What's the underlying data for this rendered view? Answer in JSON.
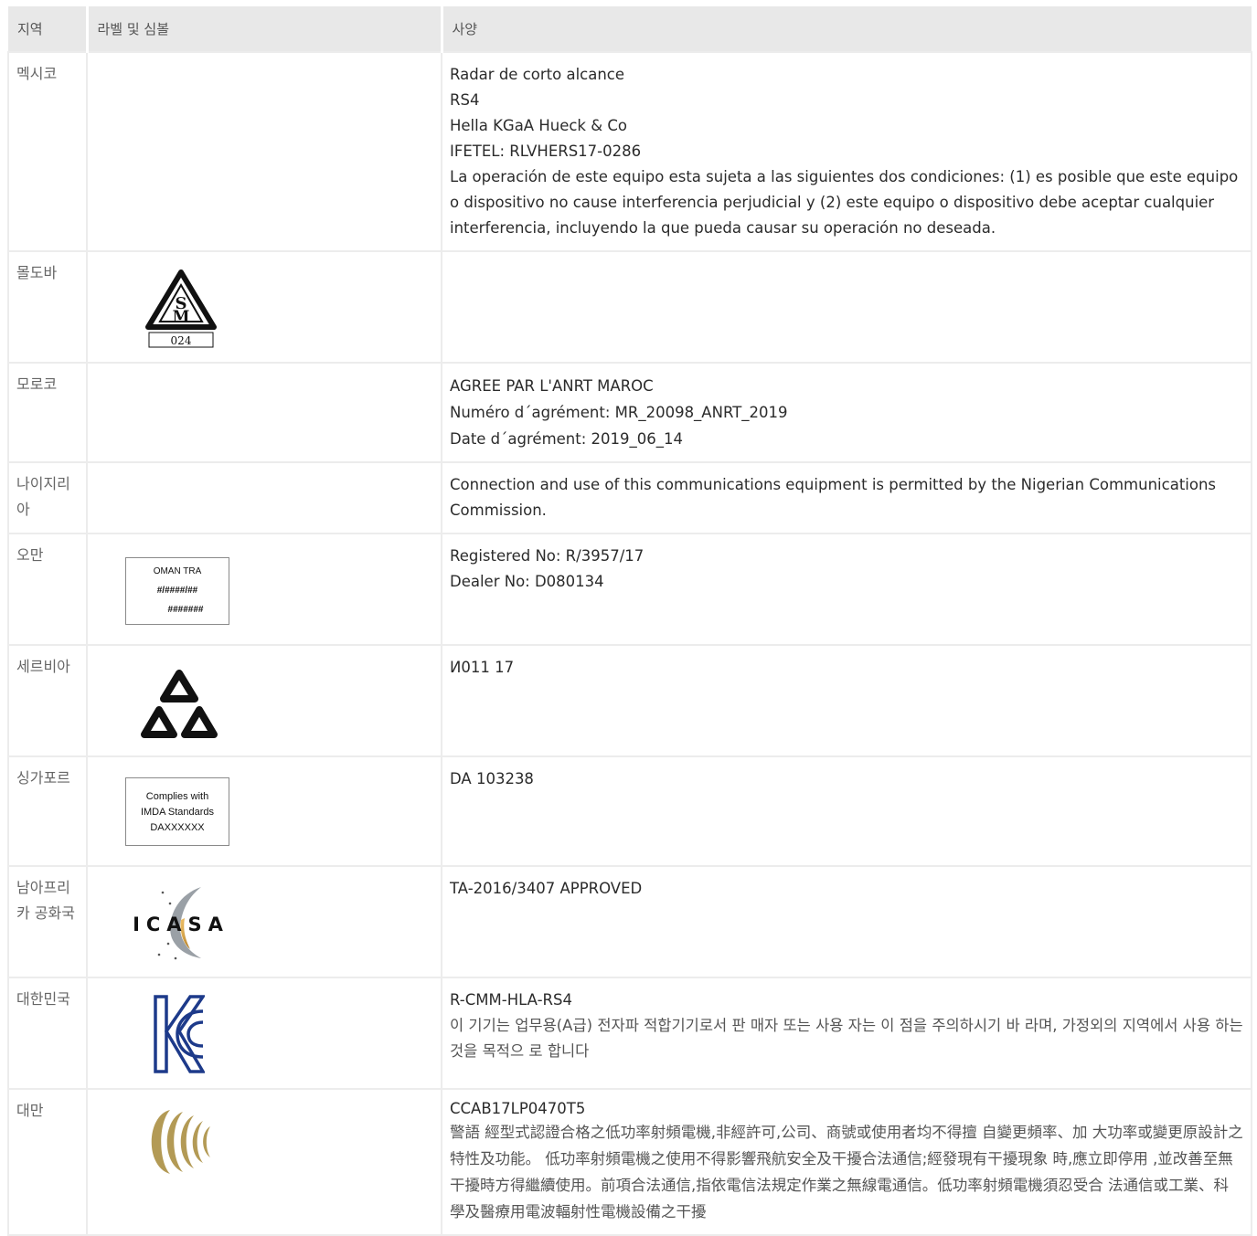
{
  "header": {
    "region": "지역",
    "label": "라벨 및 심볼",
    "spec": "사양"
  },
  "rows": [
    {
      "region": "멕시코",
      "spec": [
        "Radar de corto alcance",
        "RS4",
        "Hella KGaA Hueck & Co",
        "IFETEL: RLVHERS17-0286",
        "La operación de este equipo esta sujeta a las siguientes dos condiciones: (1) es posible que este equipo o dispositivo no cause interferencia perjudicial y (2) este equipo o dispositivo debe aceptar cualquier interferencia, incluyendo la que pueda causar su operación no deseada."
      ]
    },
    {
      "region": "몰도바",
      "label_logo": "moldova-sm-mark",
      "label_text": "024"
    },
    {
      "region": "모로코",
      "spec": [
        "AGREE PAR L'ANRT MAROC",
        "Numéro d´agrément: MR_20098_ANRT_2019",
        "Date d´agrément: 2019_06_14"
      ]
    },
    {
      "region": "나이지리아",
      "spec": [
        "Connection and use of this communications equipment is permitted by the Nigerian Communications Commission."
      ]
    },
    {
      "region": "오만",
      "label_box": [
        "OMAN TRA",
        "#/####/##",
        "#######"
      ],
      "spec": [
        "Registered No: R/3957/17",
        "Dealer No: D080134"
      ]
    },
    {
      "region": "세르비아",
      "label_logo": "serbia-triangles-mark",
      "spec": [
        "И011 17"
      ]
    },
    {
      "region": "싱가포르",
      "label_box": [
        "Complies with",
        "IMDA Standards",
        "DAXXXXXX"
      ],
      "spec": [
        "DA 103238"
      ]
    },
    {
      "region": "남아프리카 공화국",
      "label_logo": "icasa-logo",
      "label_text": "ICASA",
      "spec": [
        "TA-2016/3407 APPROVED"
      ]
    },
    {
      "region": "대한민국",
      "label_logo": "kc-mark",
      "spec": [
        "R-CMM-HLA-RS4",
        "이 기기는 업무용(A급) 전자파 적합기기로서 판 매자 또는 사용 자는 이 점을 주의하시기 바 라며, 가정외의 지역에서 사용 하는 것을 목적으 로 합니다"
      ]
    },
    {
      "region": "대만",
      "label_logo": "ncc-mark",
      "spec": [
        "CCAB17LP0470T5",
        "警語 經型式認證合格之低功率射頻電機,非經許可,公司、商號或使用者均不得擅 自變更頻率、加 大功率或變更原設計之特性及功能。 低功率射頻電機之使用不得影響飛航安全及干擾合法通信;經發現有干擾現象 時,應立即停用 ,並改善至無干擾時方得繼續使用。前項合法通信,指依電信法規定作業之無線電通信。低功率射頻電機須忍受合 法通信或工業、科學及醫療用電波輻射性電機設備之干擾"
      ]
    }
  ],
  "colors": {
    "header_bg": "#e8e8e8",
    "border": "#ececec",
    "kc_blue": "#1d3a8a",
    "ncc_gold": "#b39a55"
  }
}
